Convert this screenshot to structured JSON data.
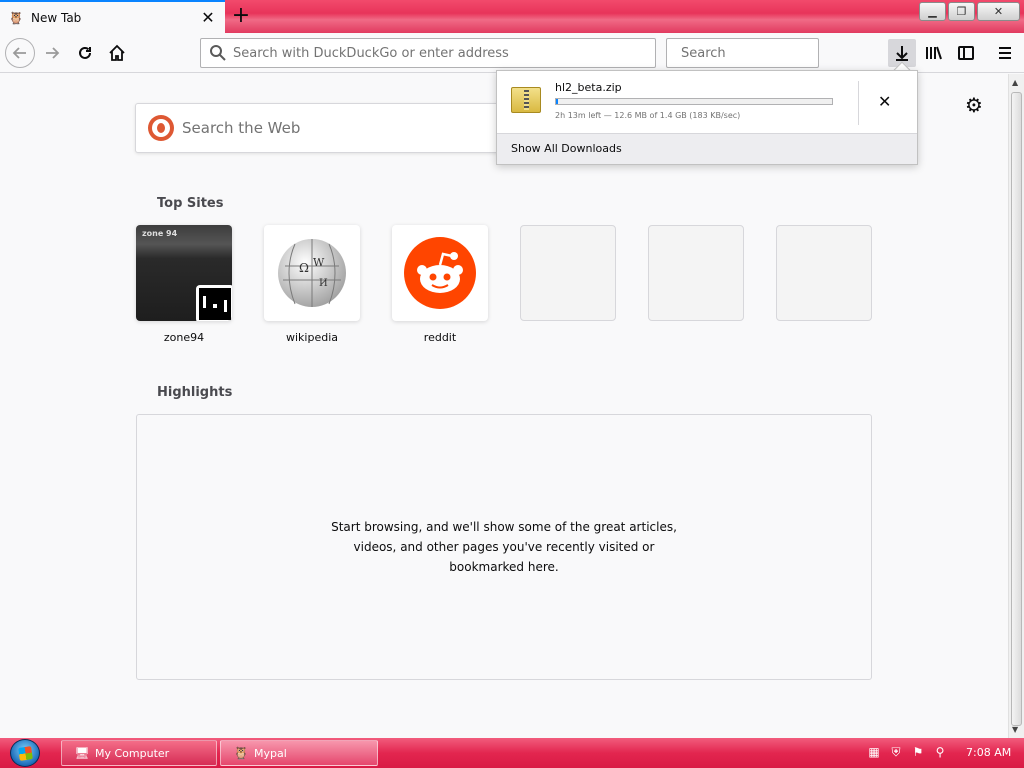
{
  "browser": {
    "tab": {
      "title": "New Tab"
    },
    "urlbar": {
      "placeholder": "Search with DuckDuckGo or enter address"
    },
    "searchbar": {
      "placeholder": "Search"
    }
  },
  "newtab": {
    "search_placeholder": "Search the Web",
    "top_sites_title": "Top Sites",
    "top_sites": [
      {
        "label": "zone94",
        "icon": "zone94-thumbnail"
      },
      {
        "label": "wikipedia",
        "icon": "wikipedia-globe-icon"
      },
      {
        "label": "reddit",
        "icon": "reddit-icon"
      },
      {
        "label": "",
        "icon": ""
      },
      {
        "label": "",
        "icon": ""
      },
      {
        "label": "",
        "icon": ""
      }
    ],
    "highlights_title": "Highlights",
    "highlights_message": "Start browsing, and we'll show some of the great articles, videos, and other pages you've recently visited or bookmarked here."
  },
  "downloads": {
    "file_name": "hl2_beta.zip",
    "status": "2h 13m left — 12.6 MB of 1.4 GB (183 KB/sec)",
    "progress_fraction": 0.009,
    "show_all_label": "Show All Downloads"
  },
  "taskbar": {
    "items": [
      {
        "label": "My Computer"
      },
      {
        "label": "Mypal"
      }
    ],
    "clock": "7:08 AM"
  },
  "colors": {
    "accent": "#0a84ff",
    "taskbar": "#e3264f",
    "reddit": "#ff4500",
    "duckduckgo": "#de5833"
  }
}
